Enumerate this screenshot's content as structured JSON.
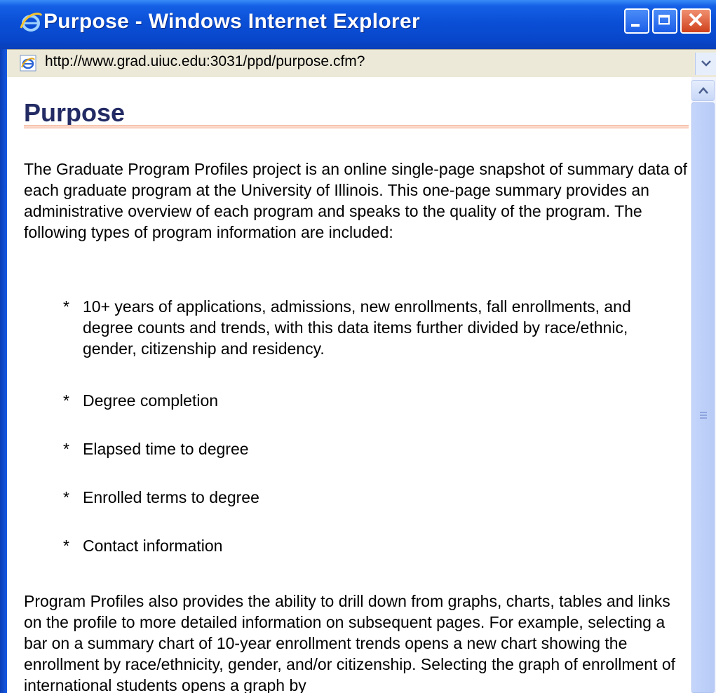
{
  "window": {
    "title": "Purpose - Windows Internet Explorer",
    "icon": "ie-logo-icon",
    "controls": [
      "minimize-icon",
      "maximize-icon",
      "close-icon"
    ]
  },
  "addressbar": {
    "url": "http://www.grad.uiuc.edu:3031/ppd/purpose.cfm?",
    "icon": "ie-page-icon"
  },
  "page": {
    "title": "Purpose",
    "intro": "The Graduate Program Profiles project is an online single-page snapshot of summary data of each graduate program at the University of Illinois. This one-page summary provides an administrative overview of each program and speaks to the quality of the program. The following types of program information are included:",
    "bullet_marker": "*",
    "bullets": [
      "10+ years of applications, admissions, new enrollments, fall enrollments, and degree counts and trends, with this data items further divided by race/ethnic, gender, citizenship and residency.",
      "Degree completion",
      "Elapsed time to degree",
      "Enrolled terms to degree",
      "Contact information"
    ],
    "drilldown": "Program Profiles also provides the ability to drill down from graphs, charts, tables and links on the profile to more detailed information on subsequent pages. For example, selecting a bar on a summary chart of 10-year enrollment trends opens a new chart showing the enrollment by race/ethnicity, gender, and/or citizenship. Selecting the graph of enrollment of international students opens a graph by"
  },
  "colors": {
    "title_text": "#232b64",
    "title_rule": "#f5b79c",
    "titlebar": "#0a4fd6",
    "close_button": "#d0401c"
  }
}
